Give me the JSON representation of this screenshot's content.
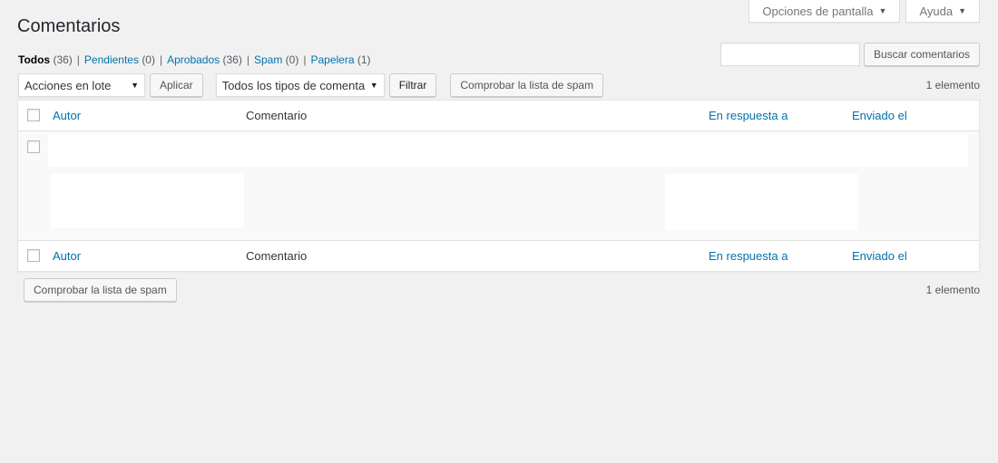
{
  "top_tabs": {
    "screen_options": "Opciones de pantalla",
    "help": "Ayuda"
  },
  "page_title": "Comentarios",
  "filters": [
    {
      "label": "Todos",
      "count": "(36)",
      "current": true
    },
    {
      "label": "Pendientes",
      "count": "(0)",
      "current": false
    },
    {
      "label": "Aprobados",
      "count": "(36)",
      "current": false
    },
    {
      "label": "Spam",
      "count": "(0)",
      "current": false
    },
    {
      "label": "Papelera",
      "count": "(1)",
      "current": false
    }
  ],
  "search": {
    "button": "Buscar comentarios",
    "value": ""
  },
  "tablenav_top": {
    "bulk_actions": "Acciones en lote",
    "apply": "Aplicar",
    "comment_type": "Todos los tipos de comentarios",
    "filter": "Filtrar",
    "check_spam": "Comprobar la lista de spam",
    "count": "1 elemento"
  },
  "columns": {
    "author": "Autor",
    "comment": "Comentario",
    "in_response_to": "En respuesta a",
    "submitted": "Enviado el"
  },
  "tablenav_bottom": {
    "check_spam": "Comprobar la lista de spam",
    "count": "1 elemento"
  }
}
